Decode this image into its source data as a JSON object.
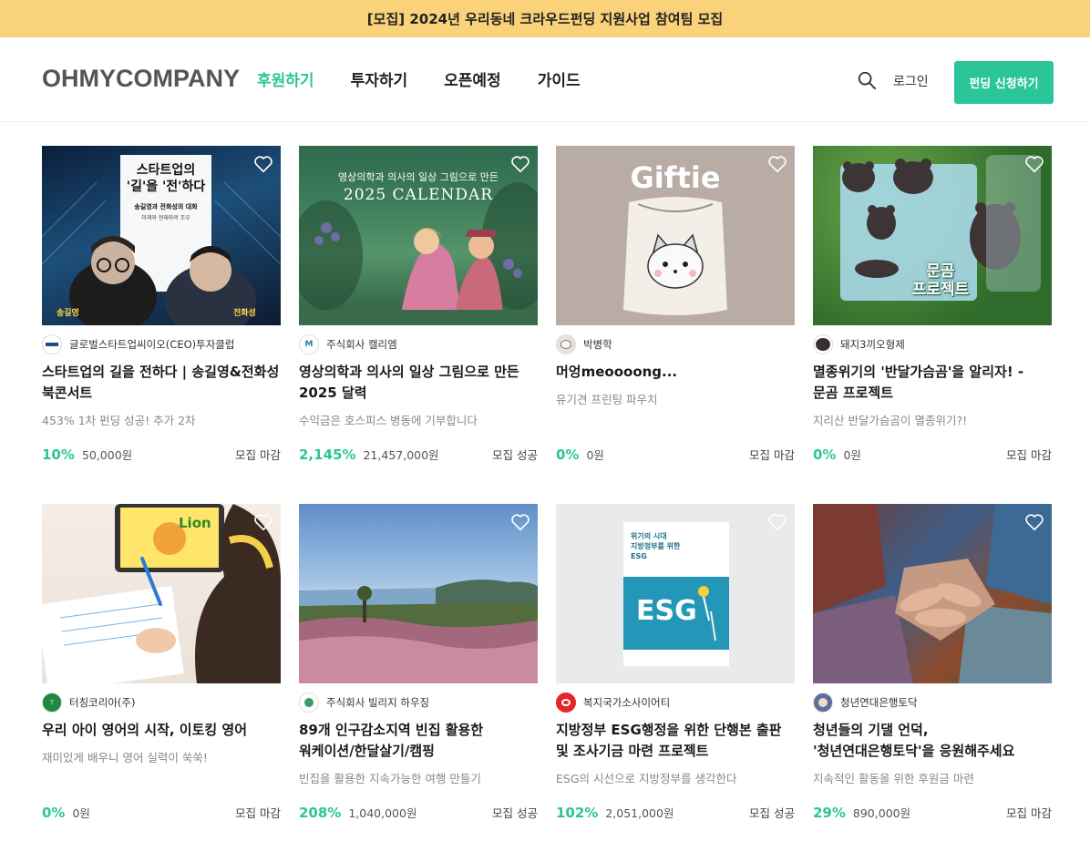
{
  "banner": {
    "text": "[모집] 2024년 우리동네 크라우드펀딩 지원사업 참여팀 모집"
  },
  "header": {
    "logo": "OHMYCOMPANY",
    "nav": [
      "후원하기",
      "투자하기",
      "오픈예정",
      "가이드"
    ],
    "login": "로그인",
    "cta": "펀딩 신청하기"
  },
  "colors": {
    "accent": "#2bc59a",
    "banner": "#f9d27a"
  },
  "cards": [
    {
      "maker": "글로벌스타트업씨이오(CEO)투자클럽",
      "title": "스타트업의 길을 전하다 | 송길영&전화성 북콘서트",
      "subtitle": "453% 1차 펀딩 성공! 추가 2차",
      "percent": "10%",
      "amount": "50,000원",
      "status": "모집 마감",
      "image": {
        "headline": "스타트업의\n'길'을 '전'하다",
        "sub": "송길영과 전화성의 대화",
        "sub2": "미래와 현재와의 조우",
        "left_name": "송길영",
        "right_name": "전화성"
      }
    },
    {
      "maker": "주식회사 캘리엠",
      "title": "영상의학과 의사의 일상 그림으로 만든 2025 달력",
      "subtitle": "수익금은 호스피스 병동에 기부합니다",
      "percent": "2,145%",
      "amount": "21,457,000원",
      "status": "모집 성공",
      "image": {
        "headline": "영상의학과 의사의 일상 그림으로 만든",
        "sub": "2025 CALENDAR"
      }
    },
    {
      "maker": "박병학",
      "title": "머엉meoooong...",
      "subtitle": "유기견 프린팅 파우치",
      "percent": "0%",
      "amount": "0원",
      "status": "모집 마감",
      "image": {
        "headline": "Giftie"
      }
    },
    {
      "maker": "돼지3끼오형제",
      "title": "멸종위기의 '반달가슴곰'을 알리자! - 문곰 프로젝트",
      "subtitle": "지리산 반달가슴곰이 멸종위기?!",
      "percent": "0%",
      "amount": "0원",
      "status": "모집 마감",
      "image": {
        "headline": "문곰\n프로젝트"
      }
    },
    {
      "maker": "터칭코리아(주)",
      "title": "우리 아이 영어의 시작, 이토킹 영어",
      "subtitle": "재미있게 배우니 영어 실력이 쑥쑥!",
      "percent": "0%",
      "amount": "0원",
      "status": "모집 마감",
      "image": {
        "headline": "Lion"
      }
    },
    {
      "maker": "주식회사 빌리지 하우징",
      "title": "89개 인구감소지역 빈집 활용한 워케이션/한달살기/캠핑",
      "subtitle": "빈집을 활용한 지속가능한 여행 만들기",
      "percent": "208%",
      "amount": "1,040,000원",
      "status": "모집 성공",
      "image": {}
    },
    {
      "maker": "복지국가소사이어티",
      "title": "지방정부 ESG행정을 위한 단행본 출판 및 조사기금 마련 프로젝트",
      "subtitle": "ESG의 시선으로 지방정부를 생각한다",
      "percent": "102%",
      "amount": "2,051,000원",
      "status": "모집 성공",
      "image": {
        "headline": "위기의 시대\n지방정부를 위한\nESG",
        "sub": "ESG"
      }
    },
    {
      "maker": "청년연대은행토닥",
      "title": "청년들의 기댈 언덕, '청년연대은행토닥'을 응원해주세요",
      "subtitle": "지속적인 활동을 위한 후원금 마련",
      "percent": "29%",
      "amount": "890,000원",
      "status": "모집 마감",
      "image": {}
    }
  ]
}
